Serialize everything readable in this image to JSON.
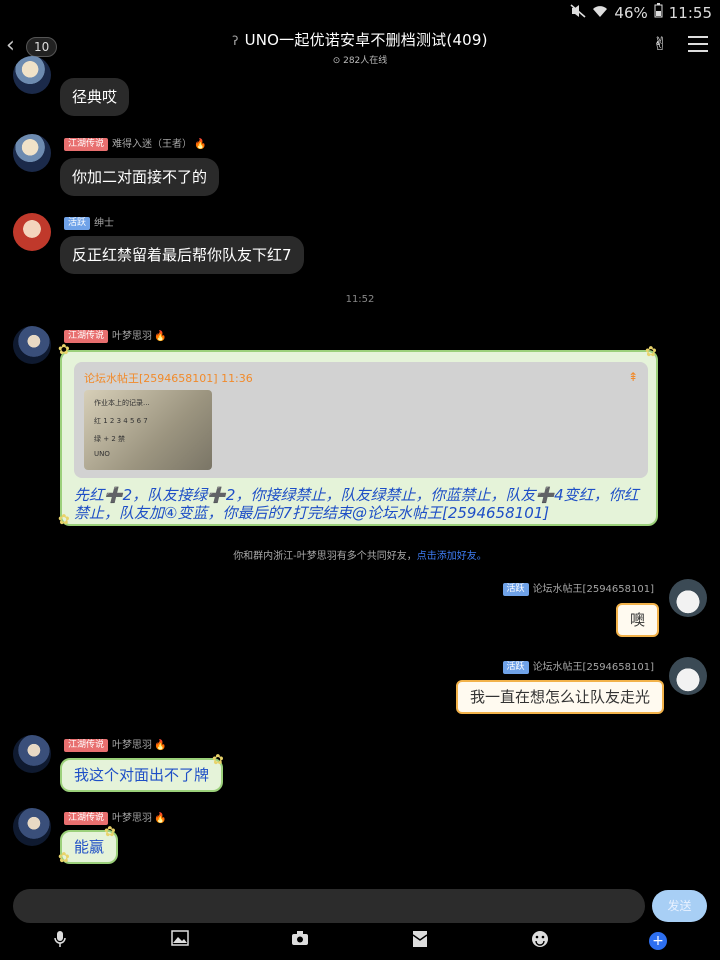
{
  "status": {
    "battery": "46%",
    "time": "11:55"
  },
  "header": {
    "unread_count": "10",
    "title": "UNO一起优诺安卓不删档测试(409)",
    "online": "282人在线"
  },
  "messages": [
    {
      "text": "径典哎"
    },
    {
      "tag": "江湖传说",
      "name": "难得入迷（王者）",
      "text": "你加二对面接不了的"
    },
    {
      "tag": "活跃",
      "name": "绅士",
      "text": "反正红禁留着最后帮你队友下红7"
    },
    {
      "tag": "江湖传说",
      "name": "叶梦思羽"
    },
    {
      "tag": "活跃",
      "name": "论坛水帖王[2594658101]",
      "text": "噢"
    },
    {
      "tag": "活跃",
      "name": "论坛水帖王[2594658101]",
      "text": "我一直在想怎么让队友走光"
    },
    {
      "tag": "江湖传说",
      "name": "叶梦思羽",
      "text": "我这个对面出不了牌"
    },
    {
      "tag": "江湖传说",
      "name": "叶梦思羽",
      "text": "能赢"
    }
  ],
  "timestamp": "11:52",
  "card": {
    "quote_header": "论坛水帖王[2594658101] 11:36",
    "image_lines": [
      "作业本上的记录...",
      "红 1 2 3 4 5 6 7",
      "绿 + 2 禁",
      "UNO"
    ],
    "text": "先红➕2，队友接绿➕2，你接绿禁止，队友绿禁止，你蓝禁止，队友➕4变红，你红禁止，队友加④变蓝，你最后的7打完结束@论坛水帖王[2594658101]"
  },
  "system_note": {
    "text": "你和群内浙江-叶梦思羽有多个共同好友，",
    "link": "点击添加好友。"
  },
  "input": {
    "send_label": "发送"
  },
  "icons": {
    "mute": "mute-icon",
    "wifi": "wifi-icon",
    "battery": "battery-icon",
    "back": "chevron-left-icon",
    "group_profile": "hand-gesture-icon",
    "menu": "menu-icon",
    "tools": [
      "microphone-icon",
      "image-icon",
      "camera-icon",
      "red-packet-icon",
      "emoji-icon",
      "plus-icon"
    ]
  },
  "colors": {
    "green_bubble_text": "#1e4fc6",
    "tag_red": "#e86f6f",
    "tag_blue": "#6fa2e8",
    "send_button": "#a8cff5"
  }
}
